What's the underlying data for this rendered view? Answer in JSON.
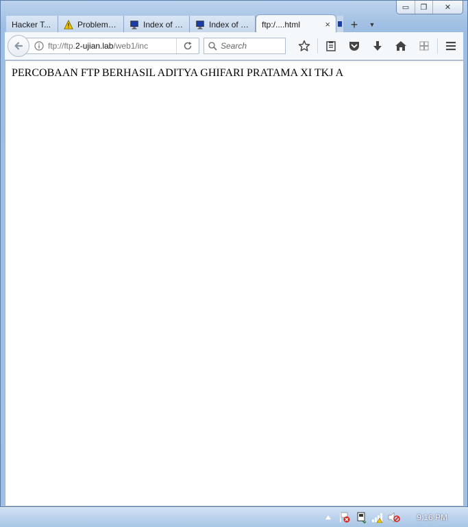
{
  "window": {
    "minimize_glyph": "▭",
    "restore_glyph": "❐",
    "close_glyph": "✕"
  },
  "tabs": [
    {
      "label": "Hacker T...",
      "icon": "none",
      "active": false
    },
    {
      "label": "Problem l...",
      "icon": "warning-icon",
      "active": false
    },
    {
      "label": "Index of f...",
      "icon": "monitor-icon",
      "active": false
    },
    {
      "label": "Index of f...",
      "icon": "monitor-icon",
      "active": false
    },
    {
      "label": "ftp:/....html",
      "icon": "none",
      "active": true
    }
  ],
  "tab_close_glyph": "×",
  "new_tab_glyph": "+",
  "tab_list_glyph": "▼",
  "urlbar": {
    "prefix": "ftp://ftp.",
    "domain": "2-ujian.lab",
    "suffix": "/web1/inc"
  },
  "search": {
    "placeholder": "Search"
  },
  "page": {
    "body_text": "PERCOBAAN FTP BERHASIL ADITYA GHIFARI PRATAMA XI TKJ A"
  },
  "taskbar": {
    "clock": "9:16 PM",
    "tray_icons": [
      "show-hidden-icons",
      "action-center-icon",
      "usb-device-icon",
      "network-icon",
      "volume-muted-icon"
    ]
  },
  "colors": {
    "accent": "#3b6fb6",
    "warning": "#f3c400",
    "error": "#d9261c"
  }
}
